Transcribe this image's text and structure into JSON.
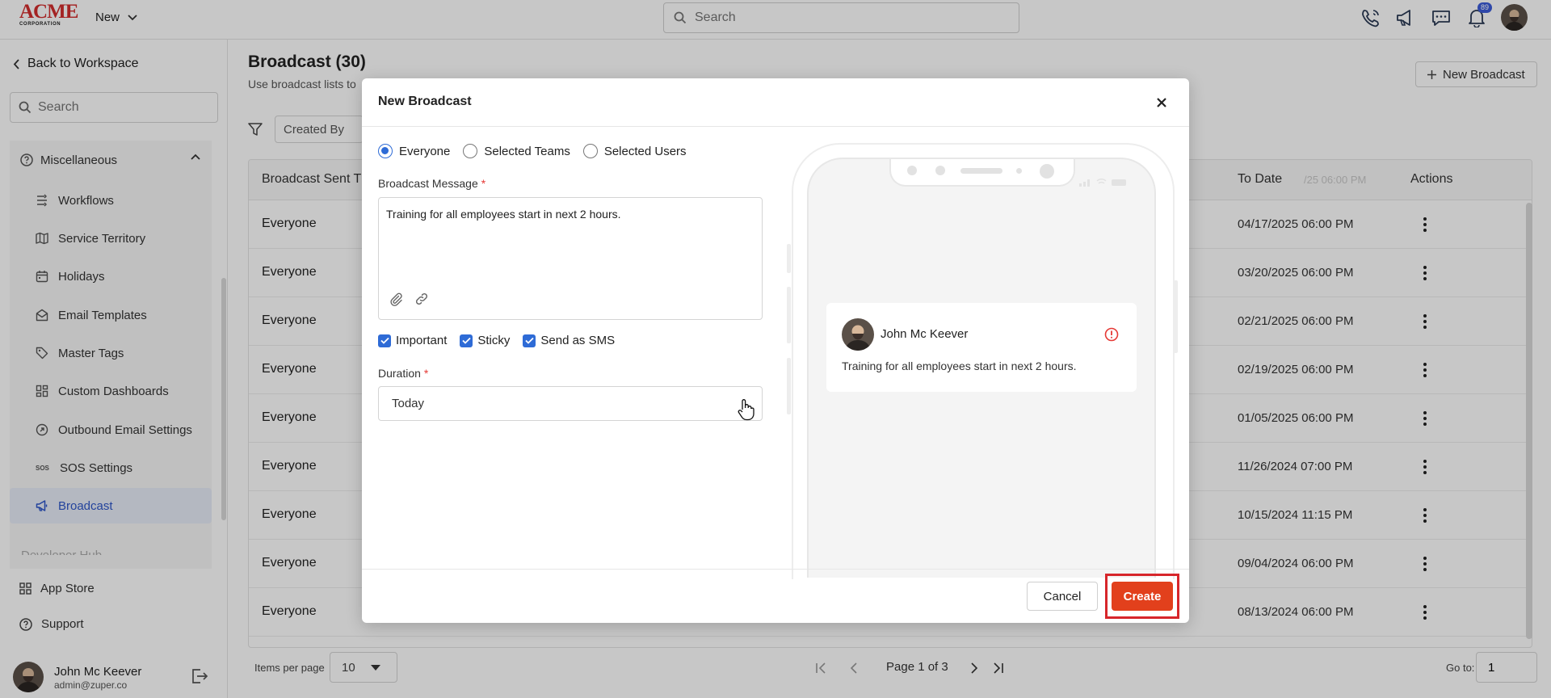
{
  "app": {
    "logo_text": "ACME",
    "logo_sub": "CORPORATION",
    "new_menu_label": "New",
    "search_placeholder": "Search",
    "notification_count": "89"
  },
  "sidebar": {
    "back_label": "Back to Workspace",
    "search_placeholder": "Search",
    "group_label": "Miscellaneous",
    "items": [
      {
        "label": "Workflows",
        "icon": "workflow-icon"
      },
      {
        "label": "Service Territory",
        "icon": "map-icon"
      },
      {
        "label": "Holidays",
        "icon": "calendar-icon"
      },
      {
        "label": "Email Templates",
        "icon": "email-icon"
      },
      {
        "label": "Master Tags",
        "icon": "tag-icon"
      },
      {
        "label": "Custom Dashboards",
        "icon": "dashboard-icon"
      },
      {
        "label": "Outbound Email Settings",
        "icon": "outbound-icon"
      },
      {
        "label": "SOS Settings",
        "icon": "sos-icon"
      },
      {
        "label": "Broadcast",
        "icon": "megaphone-icon",
        "active": true
      }
    ],
    "cutoff_label": "Developer Hub",
    "app_store_label": "App Store",
    "support_label": "Support",
    "user": {
      "name": "John Mc Keever",
      "email": "admin@zuper.co"
    }
  },
  "main": {
    "title": "Broadcast (30)",
    "subtitle": "Use broadcast lists to",
    "new_button_label": "New Broadcast",
    "filter_label": "Created By",
    "columns": {
      "sent_to": "Broadcast Sent T",
      "to_date": "To Date",
      "to_date_ghost": "/25 06:00 PM",
      "actions": "Actions"
    },
    "rows": [
      {
        "sent_to": "Everyone",
        "to_date": "04/17/2025 06:00 PM"
      },
      {
        "sent_to": "Everyone",
        "to_date": "03/20/2025 06:00 PM"
      },
      {
        "sent_to": "Everyone",
        "to_date": "02/21/2025 06:00 PM"
      },
      {
        "sent_to": "Everyone",
        "to_date": "02/19/2025 06:00 PM"
      },
      {
        "sent_to": "Everyone",
        "to_date": "01/05/2025 06:00 PM"
      },
      {
        "sent_to": "Everyone",
        "to_date": "11/26/2024 07:00 PM"
      },
      {
        "sent_to": "Everyone",
        "to_date": "10/15/2024 11:15 PM"
      },
      {
        "sent_to": "Everyone",
        "to_date": "09/04/2024 06:00 PM"
      },
      {
        "sent_to": "Everyone",
        "to_date": "08/13/2024 06:00 PM"
      }
    ],
    "pagination": {
      "items_per_page_label": "Items per page",
      "items_per_page": "10",
      "page_text": "Page 1 of 3",
      "goto_label": "Go to:",
      "goto_value": "1"
    }
  },
  "modal": {
    "title": "New Broadcast",
    "recipients": [
      {
        "label": "Everyone",
        "selected": true
      },
      {
        "label": "Selected Teams",
        "selected": false
      },
      {
        "label": "Selected Users",
        "selected": false
      }
    ],
    "message_label": "Broadcast Message",
    "required_mark": "*",
    "message_text": "Training for all employees start in next 2 hours.",
    "options": [
      {
        "label": "Important",
        "checked": true
      },
      {
        "label": "Sticky",
        "checked": true
      },
      {
        "label": "Send as SMS",
        "checked": true
      }
    ],
    "duration_label": "Duration",
    "duration_value": "Today",
    "cancel_label": "Cancel",
    "create_label": "Create",
    "preview": {
      "sender_name": "John Mc Keever",
      "message": "Training for all employees start in next 2 hours."
    }
  },
  "colors": {
    "accent_blue": "#2e6bd6",
    "create_orange": "#e2401c",
    "highlight_red": "#d7262b",
    "sidebar_active_bg": "#e7ecf8"
  }
}
